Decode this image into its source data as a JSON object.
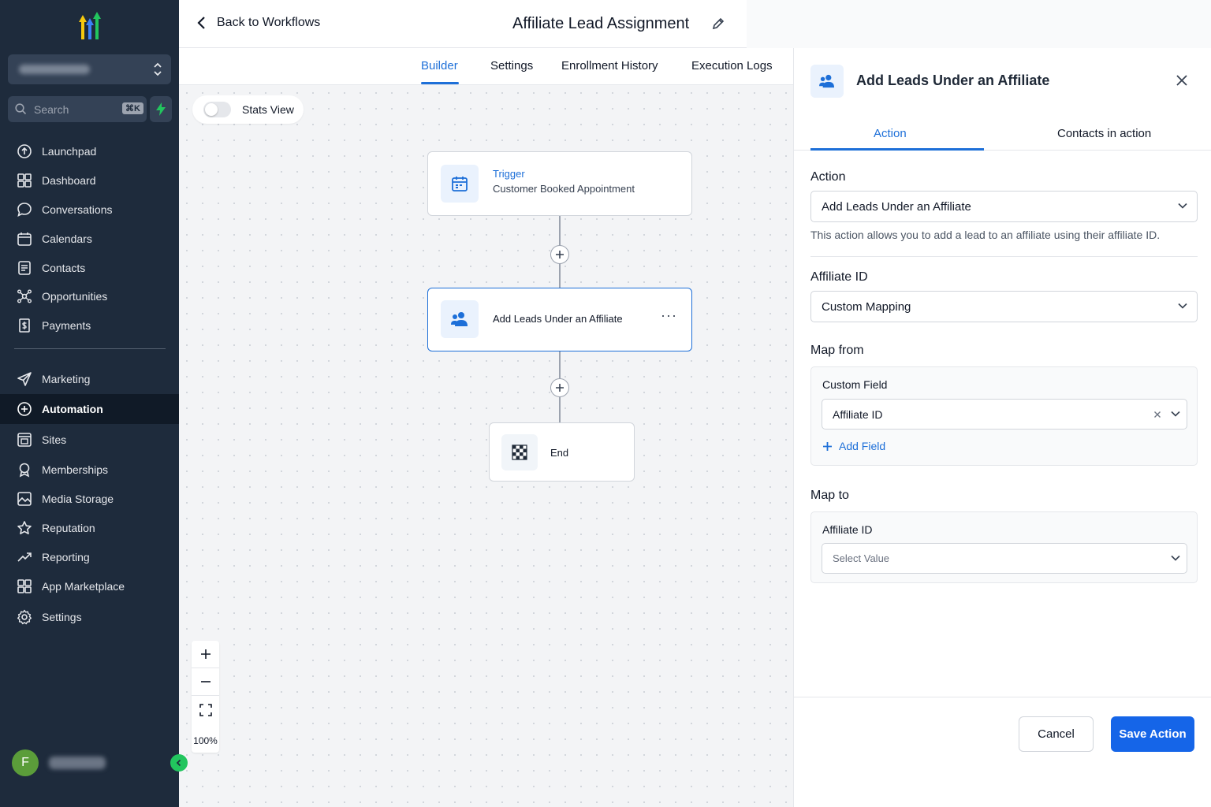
{
  "sidebar": {
    "search": {
      "placeholder": "Search",
      "shortcut": "⌘K"
    },
    "items": [
      {
        "label": "Launchpad",
        "icon": "launchpad-icon"
      },
      {
        "label": "Dashboard",
        "icon": "dashboard-icon"
      },
      {
        "label": "Conversations",
        "icon": "chat-icon"
      },
      {
        "label": "Calendars",
        "icon": "calendar-icon"
      },
      {
        "label": "Contacts",
        "icon": "contacts-icon"
      },
      {
        "label": "Opportunities",
        "icon": "opportunities-icon"
      },
      {
        "label": "Payments",
        "icon": "payments-icon"
      },
      {
        "label": "Marketing",
        "icon": "send-icon"
      },
      {
        "label": "Automation",
        "icon": "automation-icon"
      },
      {
        "label": "Sites",
        "icon": "sites-icon"
      },
      {
        "label": "Memberships",
        "icon": "badge-icon"
      },
      {
        "label": "Media Storage",
        "icon": "image-icon"
      },
      {
        "label": "Reputation",
        "icon": "star-icon"
      },
      {
        "label": "Reporting",
        "icon": "trend-icon"
      },
      {
        "label": "App Marketplace",
        "icon": "grid-icon"
      },
      {
        "label": "Settings",
        "icon": "gear-icon"
      }
    ],
    "active": "Automation",
    "user_initial": "F"
  },
  "header": {
    "back_label": "Back to Workflows",
    "title": "Affiliate Lead Assignment"
  },
  "tabs": [
    "Builder",
    "Settings",
    "Enrollment History",
    "Execution Logs"
  ],
  "canvas": {
    "stats_view_label": "Stats View",
    "trigger": {
      "label": "Trigger",
      "name": "Customer Booked Appointment"
    },
    "action_node": "Add Leads Under an Affiliate",
    "end_node": "End",
    "zoom_level": "100%"
  },
  "panel": {
    "title": "Add Leads Under an Affiliate",
    "tabs": [
      "Action",
      "Contacts in action"
    ],
    "action_label": "Action",
    "action_value": "Add Leads Under an Affiliate",
    "help_text": "This action allows you to add a lead to an affiliate using their affiliate ID.",
    "affiliate_id_label": "Affiliate ID",
    "affiliate_id_value": "Custom Mapping",
    "map_from_label": "Map from",
    "custom_field_label": "Custom Field",
    "custom_field_value": "Affiliate ID",
    "add_field_label": "Add Field",
    "map_to_label": "Map to",
    "map_to_field_label": "Affiliate ID",
    "map_to_placeholder": "Select Value",
    "cancel_label": "Cancel",
    "save_label": "Save Action"
  },
  "colors": {
    "accent": "#1d6fd8",
    "sidebar_bg": "#1e2b3c",
    "save_button": "#1565e8"
  }
}
